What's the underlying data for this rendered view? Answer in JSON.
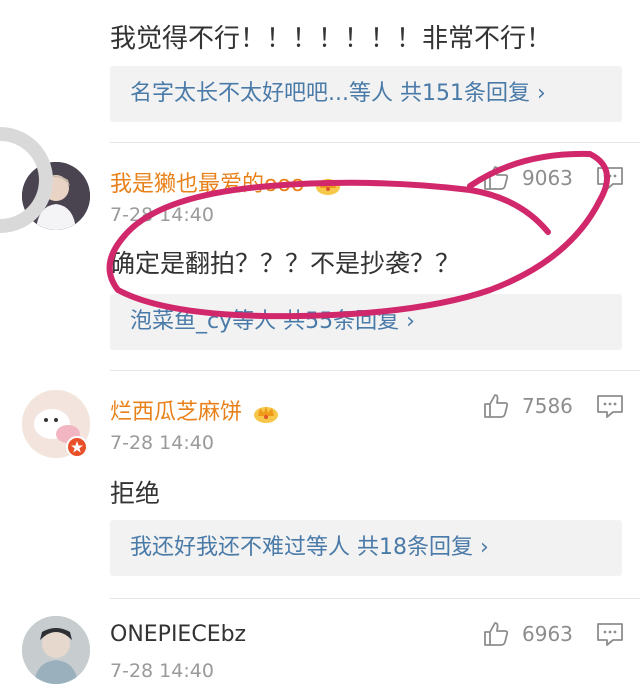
{
  "comment0": {
    "text": "我觉得不行！！！！！！！非常不行！",
    "replies": "名字太长不太好吧吧...等人  共151条回复 ›"
  },
  "comment1": {
    "name": "我是獭也最爱的ooo",
    "time": "7-28 14:40",
    "text": "确定是翻拍？？？不是抄袭？？",
    "likes": "9063",
    "replies": "泡菜鱼_cy等人  共55条回复 ›"
  },
  "comment2": {
    "name": "烂西瓜芝麻饼",
    "time": "7-28 14:40",
    "text": "拒绝",
    "likes": "7586",
    "replies": "我还好我还不难过等人  共18条回复 ›"
  },
  "comment3": {
    "name": "ONEPIECEbz",
    "time": "7-28 14:40",
    "likes": "6963"
  },
  "colors": {
    "username": "#e8811a",
    "link": "#4a7aa8",
    "annotation": "#d1286b",
    "muted": "#9a9a9a"
  },
  "icons": [
    "thumb-up-icon",
    "comment-icon",
    "crown-icon",
    "badge-icon"
  ]
}
